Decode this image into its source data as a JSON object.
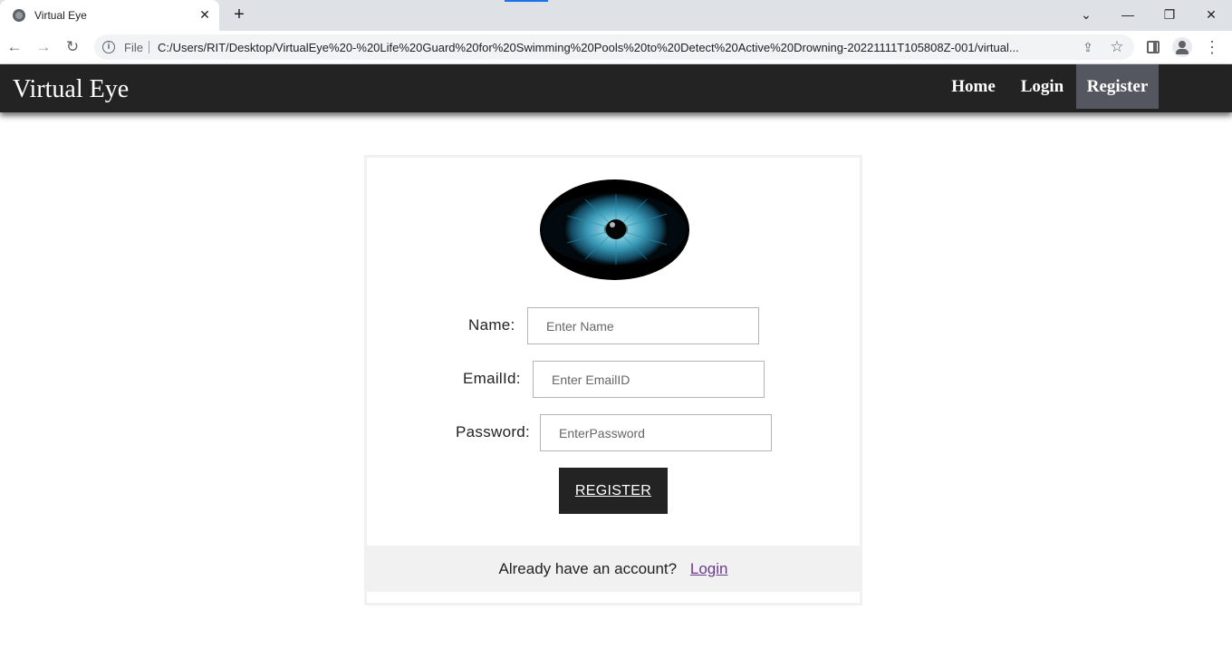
{
  "browser": {
    "tab_title": "Virtual Eye",
    "tab_close": "✕",
    "new_tab": "+",
    "scheme": "File",
    "url": "C:/Users/RIT/Desktop/VirtualEye%20-%20Life%20Guard%20for%20Swimming%20Pools%20to%20Detect%20Active%20Drowning-20221111T105808Z-001/virtual...",
    "window_controls": {
      "list_tabs": "⌄",
      "minimize": "—",
      "restore": "❐",
      "close": "✕"
    },
    "nav": {
      "back": "←",
      "forward": "→",
      "reload": "↻"
    },
    "icons": {
      "share": "⇪",
      "star": "☆",
      "menu": "⋮"
    }
  },
  "navbar": {
    "brand": "Virtual Eye",
    "links": [
      {
        "label": "Home",
        "active": false
      },
      {
        "label": "Login",
        "active": false
      },
      {
        "label": "Register",
        "active": true
      }
    ],
    "colors": {
      "background": "#232323",
      "active": "#545760"
    }
  },
  "form": {
    "name": {
      "label": "Name:",
      "placeholder": "Enter Name",
      "value": ""
    },
    "email": {
      "label": "EmailId:",
      "placeholder": "Enter EmailID",
      "value": ""
    },
    "password": {
      "label": "Password:",
      "placeholder": "EnterPassword",
      "value": ""
    },
    "submit_label": "REGISTER"
  },
  "footer": {
    "prompt": "Already have an account?",
    "login_link": "Login"
  },
  "logo": {
    "icon": "eye-icon",
    "iris_color": "#3fa9c9"
  }
}
